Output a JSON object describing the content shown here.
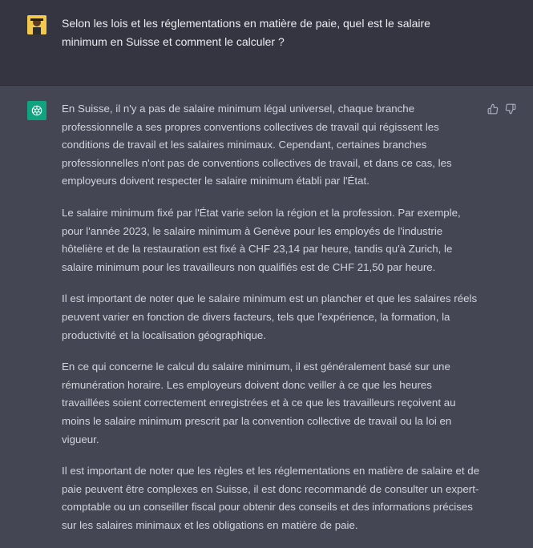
{
  "user_message": {
    "text": "Selon les lois et les réglementations en matière de paie, quel est le salaire minimum en Suisse et comment le calculer ?"
  },
  "assistant_message": {
    "paragraphs": [
      "En Suisse, il n'y a pas de salaire minimum légal universel, chaque branche professionnelle a ses propres conventions collectives de travail qui régissent les conditions de travail et les salaires minimaux. Cependant, certaines branches professionnelles n'ont pas de conventions collectives de travail, et dans ce cas, les employeurs doivent respecter le salaire minimum établi par l'État.",
      "Le salaire minimum fixé par l'État varie selon la région et la profession. Par exemple, pour l'année 2023, le salaire minimum à Genève pour les employés de l'industrie hôtelière et de la restauration est fixé à CHF 23,14 par heure, tandis qu'à Zurich, le salaire minimum pour les travailleurs non qualifiés est de CHF 21,50 par heure.",
      "Il est important de noter que le salaire minimum est un plancher et que les salaires réels peuvent varier en fonction de divers facteurs, tels que l'expérience, la formation, la productivité et la localisation géographique.",
      "En ce qui concerne le calcul du salaire minimum, il est généralement basé sur une rémunération horaire. Les employeurs doivent donc veiller à ce que les heures travaillées soient correctement enregistrées et à ce que les travailleurs reçoivent au moins le salaire minimum prescrit par la convention collective de travail ou la loi en vigueur.",
      "Il est important de noter que les règles et les réglementations en matière de salaire et de paie peuvent être complexes en Suisse, il est donc recommandé de consulter un expert-comptable ou un conseiller fiscal pour obtenir des conseils et des informations précises sur les salaires minimaux et les obligations en matière de paie."
    ]
  },
  "icons": {
    "user_avatar": "user-avatar-icon",
    "assistant_avatar": "openai-logo-icon",
    "like": "thumbs-up-icon",
    "dislike": "thumbs-down-icon"
  },
  "colors": {
    "user_bg": "#343541",
    "assistant_bg": "#444654",
    "brand": "#10a37f"
  }
}
